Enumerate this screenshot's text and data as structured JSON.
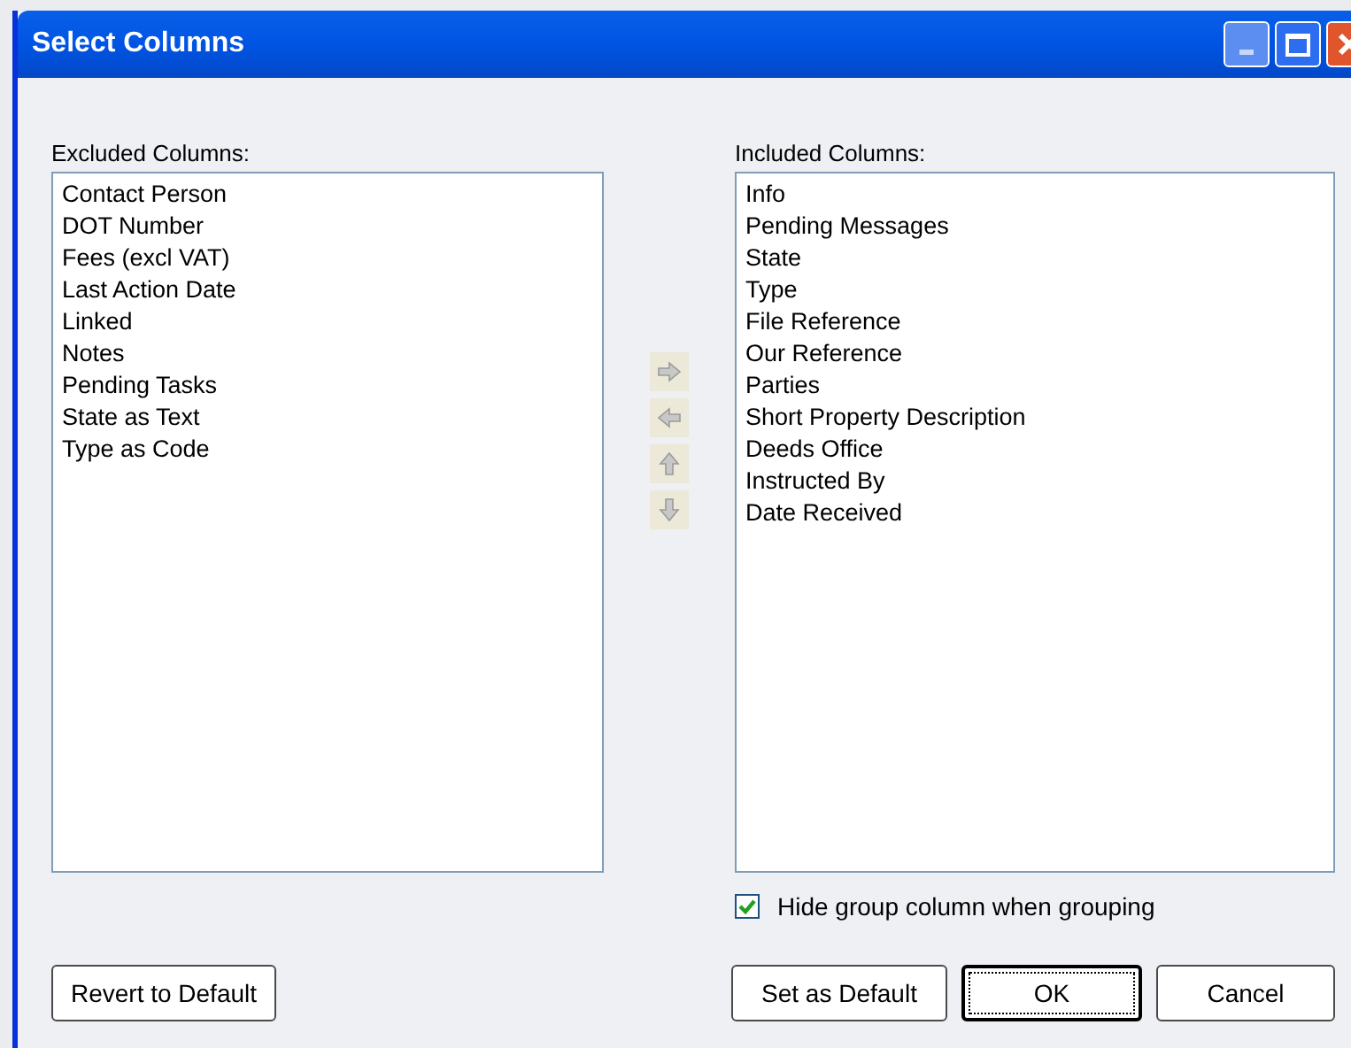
{
  "window": {
    "title": "Select Columns"
  },
  "excluded": {
    "label": "Excluded Columns:",
    "items": [
      "Contact Person",
      "DOT Number",
      "Fees (excl VAT)",
      "Last Action Date",
      "Linked",
      "Notes",
      "Pending Tasks",
      "State as Text",
      "Type as Code"
    ]
  },
  "included": {
    "label": "Included Columns:",
    "items": [
      "Info",
      "Pending Messages",
      "State",
      "Type",
      "File Reference",
      "Our Reference",
      "Parties",
      "Short Property Description",
      "Deeds Office",
      "Instructed By",
      "Date Received"
    ]
  },
  "move_buttons": [
    {
      "kind": "right",
      "disabled": true
    },
    {
      "kind": "left",
      "disabled": true
    },
    {
      "kind": "up",
      "disabled": true
    },
    {
      "kind": "down",
      "disabled": true
    }
  ],
  "hide_group_column": {
    "label": "Hide group column when grouping",
    "checked": true
  },
  "buttons": [
    {
      "label": "Revert to Default",
      "default": false
    },
    {
      "label": "Set as Default",
      "default": false
    },
    {
      "label": "OK",
      "default": true
    },
    {
      "label": "Cancel",
      "default": false
    }
  ]
}
